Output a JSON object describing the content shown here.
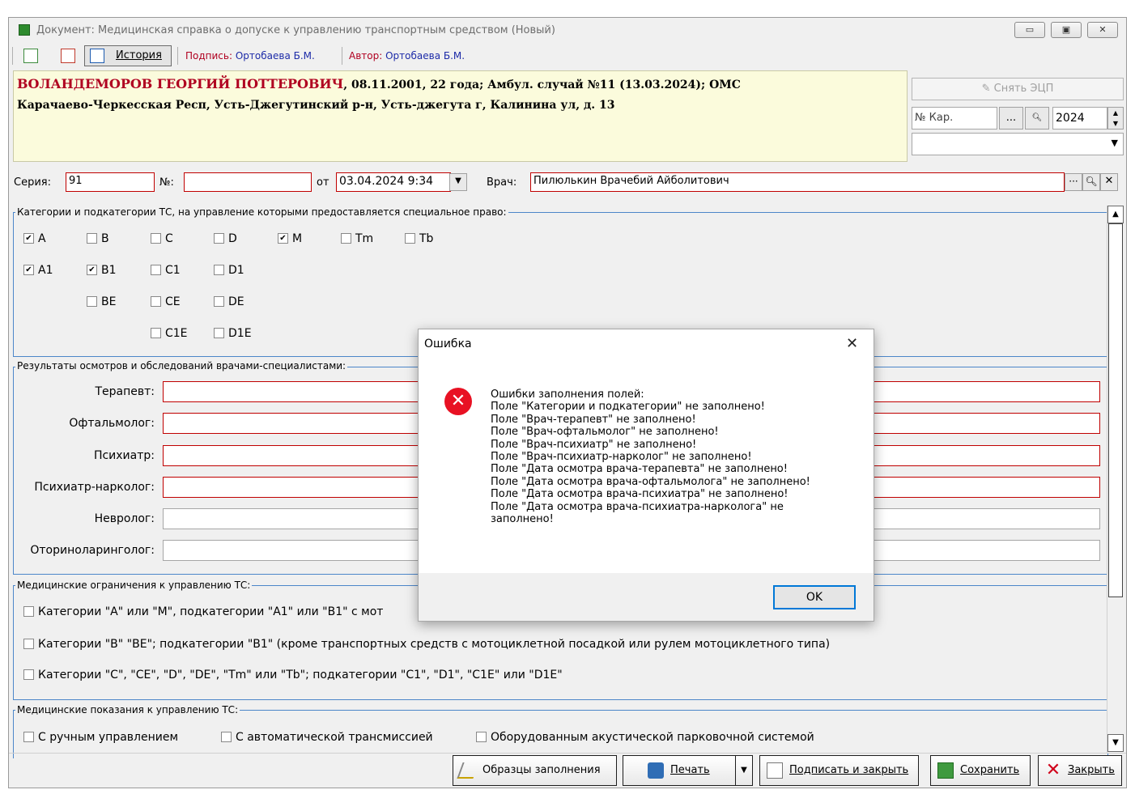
{
  "window": {
    "title": "Документ: Медицинская справка о допуске к управлению транспортным средством (Новый)",
    "controls": {
      "minimize": "▭",
      "restore": "▣",
      "close": "✕"
    }
  },
  "toolbar": {
    "history_label": "История",
    "signature_label": "Подпись:",
    "signature_value": "Ортобаева Б.М.",
    "author_label": "Автор:",
    "author_value": "Ортобаева Б.М."
  },
  "patient": {
    "name": "ВОЛАНДЕМОРОВ ГЕОРГИЙ ПОТТЕРОВИЧ",
    "info": ", 08.11.2001, 22 года; Амбул. случай №11 (13.03.2024); ОМС",
    "address": "Карачаево-Черкесская Респ, Усть-Джегутинский р-н, Усть-джегута г, Калинина ул, д. 13"
  },
  "side": {
    "remove_eds": "Снять ЭЦП",
    "card_no_placeholder": "№ Кар.",
    "ellipsis": "...",
    "year": "2024"
  },
  "form": {
    "series_label": "Серия:",
    "series_value": "91",
    "number_label": "№:",
    "number_value": "",
    "from_label": "от",
    "date_value": "03.04.2024 9:34",
    "doctor_label": "Врач:",
    "doctor_value": "Пилюлькин Врачебий Айболитович"
  },
  "categories": {
    "title": "Категории и подкатегории ТС, на управление которыми предоставляется специальное право:",
    "items": [
      {
        "label": "A",
        "checked": "✔"
      },
      {
        "label": "B",
        "checked": ""
      },
      {
        "label": "C",
        "checked": ""
      },
      {
        "label": "D",
        "checked": ""
      },
      {
        "label": "M",
        "checked": "✔"
      },
      {
        "label": "Tm",
        "checked": ""
      },
      {
        "label": "Tb",
        "checked": ""
      },
      {
        "label": "A1",
        "checked": "✔"
      },
      {
        "label": "B1",
        "checked": "✔"
      },
      {
        "label": "C1",
        "checked": ""
      },
      {
        "label": "D1",
        "checked": ""
      },
      {
        "label": "BE",
        "checked": ""
      },
      {
        "label": "CE",
        "checked": ""
      },
      {
        "label": "DE",
        "checked": ""
      },
      {
        "label": "C1E",
        "checked": ""
      },
      {
        "label": "D1E",
        "checked": ""
      }
    ]
  },
  "results": {
    "title": "Результаты осмотров и обследований врачами-специалистами:",
    "rows": [
      {
        "label": "Терапевт:",
        "value": ""
      },
      {
        "label": "Офтальмолог:",
        "value": ""
      },
      {
        "label": "Психиатр:",
        "value": ""
      },
      {
        "label": "Психиатр-нарколог:",
        "value": ""
      },
      {
        "label": "Невролог:",
        "value": ""
      },
      {
        "label": "Оториноларинголог:",
        "value": ""
      }
    ]
  },
  "restrictions": {
    "title": "Медицинские ограничения к управлению ТС:",
    "items": [
      "Категории \"A\" или \"M\", подкатегории \"A1\" или \"B1\" с мот",
      "Категории \"B\" \"BE\"; подкатегории \"B1\" (кроме транспортных средств с мотоциклетной посадкой или рулем мотоциклетного типа)",
      "Категории \"C\", \"CE\", \"D\", \"DE\", \"Tm\" или \"Tb\"; подкатегории \"C1\", \"D1\", \"C1E\" или \"D1E\""
    ]
  },
  "indications": {
    "title": "Медицинские показания к управлению ТС:",
    "items": [
      "С ручным управлением",
      "С автоматической трансмиссией",
      "Оборудованным акустической парковочной системой"
    ]
  },
  "buttons": {
    "samples": "Образцы заполнения",
    "print": "Печать",
    "sign_close": "Подписать и закрыть",
    "save": "Сохранить",
    "close": "Закрыть"
  },
  "dialog": {
    "title": "Ошибка",
    "close": "✕",
    "lines": [
      "Ошибки заполнения полей:",
      "Поле \"Категории и подкатегории\" не заполнено!",
      "Поле \"Врач-терапевт\" не заполнено!",
      "Поле \"Врач-офтальмолог\" не заполнено!",
      "Поле \"Врач-психиатр\" не заполнено!",
      "Поле \"Врач-психиатр-нарколог\" не заполнено!",
      "Поле \"Дата осмотра врача-терапевта\" не заполнено!",
      "Поле \"Дата осмотра врача-офтальмолога\" не заполнено!",
      "Поле \"Дата осмотра врача-психиатра\" не заполнено!",
      "Поле \"Дата осмотра врача-психиатра-нарколога\" не",
      "заполнено!"
    ],
    "ok": "OK"
  }
}
